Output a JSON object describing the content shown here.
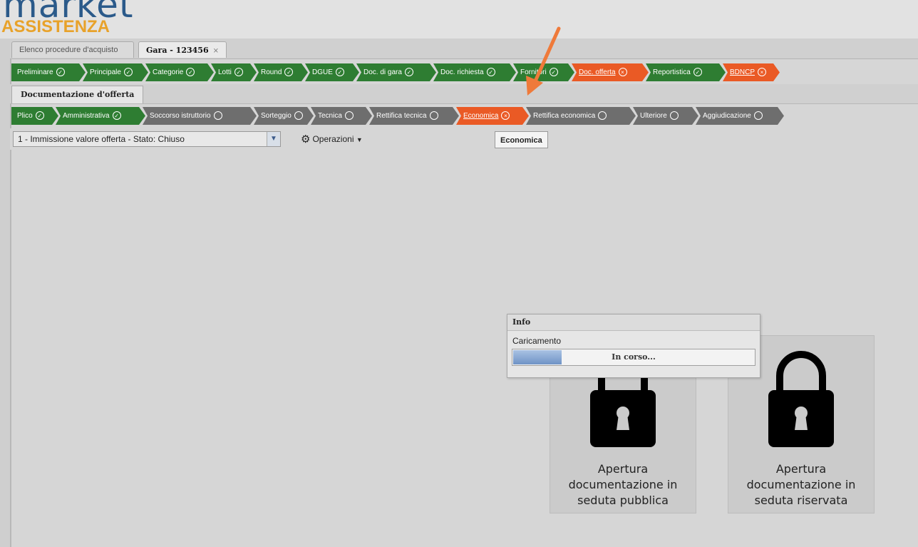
{
  "logo": {
    "brand": "market",
    "sub": "ASSISTENZA"
  },
  "tabs": [
    {
      "label": "Elenco procedure d'acquisto"
    },
    {
      "label": "Gara - 123456",
      "close": "×"
    }
  ],
  "steps_main": [
    {
      "label": "Preliminare",
      "status": "done"
    },
    {
      "label": "Principale",
      "status": "done"
    },
    {
      "label": "Categorie",
      "status": "done"
    },
    {
      "label": "Lotti",
      "status": "done"
    },
    {
      "label": "Round",
      "status": "done"
    },
    {
      "label": "DGUE",
      "status": "done"
    },
    {
      "label": "Doc. di gara",
      "status": "done"
    },
    {
      "label": "Doc. richiesta",
      "status": "done"
    },
    {
      "label": "Fornitori",
      "status": "done"
    },
    {
      "label": "Doc. offerta",
      "status": "active"
    },
    {
      "label": "Reportistica",
      "status": "done"
    },
    {
      "label": "BDNCP",
      "status": "active"
    }
  ],
  "section_tab": "Documentazione d'offerta",
  "steps_sub": [
    {
      "label": "Plico",
      "status": "done"
    },
    {
      "label": "Amministrativa",
      "status": "done"
    },
    {
      "label": "Soccorso istruttorio",
      "status": "todo"
    },
    {
      "label": "Sorteggio",
      "status": "todo"
    },
    {
      "label": "Tecnica",
      "status": "todo"
    },
    {
      "label": "Rettifica tecnica",
      "status": "todo"
    },
    {
      "label": "Economica",
      "status": "active"
    },
    {
      "label": "Rettifica economica",
      "status": "todo"
    },
    {
      "label": "Ulteriore",
      "status": "todo"
    },
    {
      "label": "Aggiudicazione",
      "status": "todo"
    }
  ],
  "toolbar": {
    "select_value": "1 - Immissione valore offerta - Stato: Chiuso",
    "operations_label": "Operazioni"
  },
  "tooltip": "Economica",
  "cards": [
    {
      "label": "Apertura documentazione in seduta pubblica"
    },
    {
      "label": "Apertura documentazione in seduta riservata"
    }
  ],
  "info_dialog": {
    "title": "Info",
    "message": "Caricamento",
    "progress_text": "In corso...",
    "progress_fraction": 0.2
  },
  "colors": {
    "done": "#2e7d32",
    "active": "#ea5a25",
    "todo": "#6e6e6e",
    "arrow": "#ef7a3a"
  },
  "icons": {
    "done": "check-circle-icon",
    "active": "cross-circle-icon",
    "todo": "empty-circle-icon"
  }
}
